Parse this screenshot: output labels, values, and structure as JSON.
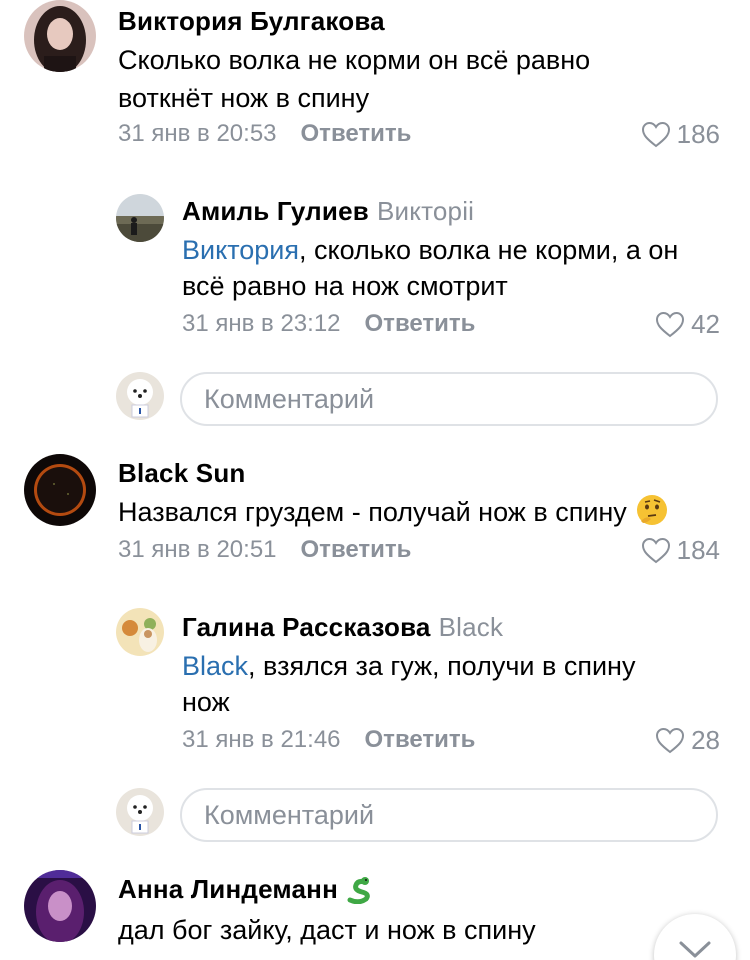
{
  "comments": [
    {
      "author": "Виктория Булгакова",
      "lines": [
        "Сколько волка не корми он всё равно",
        "воткнёт нож в спину"
      ],
      "time": "31 янв в 20:53",
      "reply_label": "Ответить",
      "likes": "186",
      "avatar_icon": "woman-dark-hair-avatar",
      "reply": {
        "author": "Амиль Гулиев",
        "reply_to": "Викторii",
        "mention": "Виктория",
        "line1_rest": ", сколько волка не корми, а он",
        "line2": "всё равно на нож смотрит",
        "time": "31 янв в 23:12",
        "reply_label": "Ответить",
        "likes": "42",
        "avatar_icon": "landscape-person-avatar"
      }
    },
    {
      "author": "Black Sun",
      "lines": [
        "Назвался груздем - получай нож в спину"
      ],
      "emoji": "thinking-face-emoji",
      "time": "31 янв в 20:51",
      "reply_label": "Ответить",
      "likes": "184",
      "avatar_icon": "solar-eclipse-avatar",
      "reply": {
        "author": "Галина Рассказова",
        "reply_to": "Black",
        "mention": "Black",
        "line1_rest": ", взялся за гуж, получи в спину",
        "line2": "нож",
        "time": "31 янв в 21:46",
        "reply_label": "Ответить",
        "likes": "28",
        "avatar_icon": "illustration-avatar"
      }
    },
    {
      "author": "Анна Линдеманн",
      "author_badge": "snake-emoji",
      "lines": [
        "дал бог зайку, даст и нож в спину"
      ],
      "avatar_icon": "woman-neon-avatar"
    }
  ],
  "comment_input": {
    "placeholder": "Комментарий",
    "avatar_icon": "white-dog-avatar"
  },
  "colors": {
    "mention": "#2a6fb0",
    "secondary_text": "#8a9099",
    "input_border": "#dfe2e6"
  }
}
